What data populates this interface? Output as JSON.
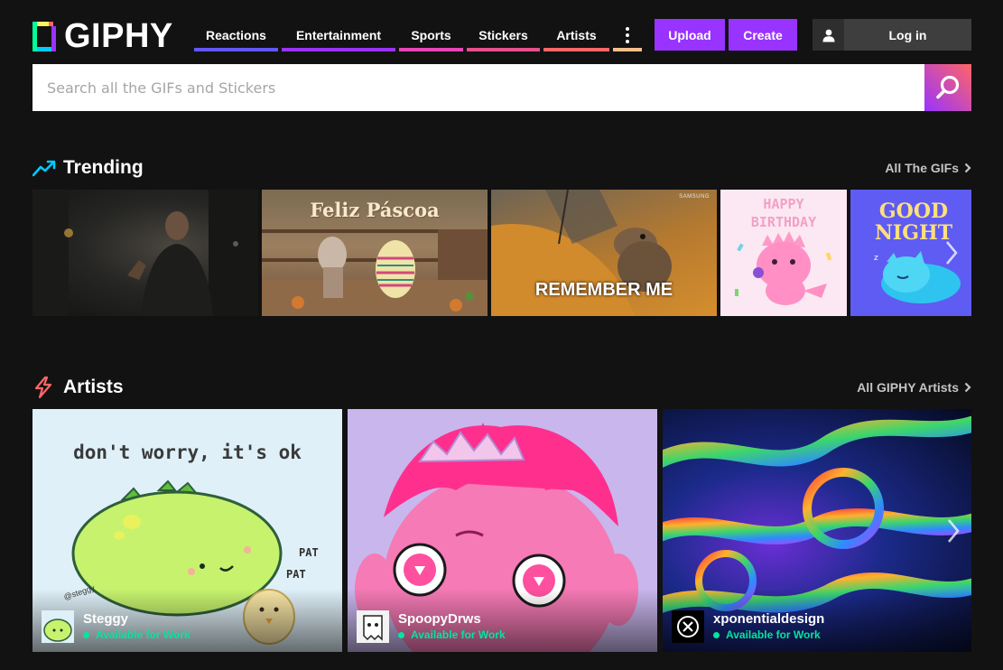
{
  "brand": {
    "name": "GIPHY"
  },
  "nav": {
    "items": [
      {
        "label": "Reactions",
        "color": "#6157ff"
      },
      {
        "label": "Entertainment",
        "color": "#9933ff"
      },
      {
        "label": "Sports",
        "color": "#e646b6"
      },
      {
        "label": "Stickers",
        "color": "#e6508c"
      },
      {
        "label": "Artists",
        "color": "#ff6666"
      }
    ],
    "more_color": "#fff35c"
  },
  "header_buttons": {
    "upload_label": "Upload",
    "create_label": "Create",
    "login_label": "Log in"
  },
  "search": {
    "placeholder": "Search all the GIFs and Stickers"
  },
  "trending": {
    "title": "Trending",
    "link_label": "All The GIFs",
    "gifs": [
      {
        "caption": ""
      },
      {
        "caption": "Feliz Páscoa"
      },
      {
        "caption": "REMEMBER ME",
        "brand": "SAMSUNG"
      },
      {
        "caption_line1": "HAPPY",
        "caption_line2": "BIRTHDAY"
      },
      {
        "caption_line1": "GOOD",
        "caption_line2": "NIGHT"
      }
    ]
  },
  "artists": {
    "title": "Artists",
    "link_label": "All GIPHY Artists",
    "cards": [
      {
        "name": "Steggy",
        "status": "Available for Work",
        "art_text": "don't worry, it's ok",
        "pat1": "PAT",
        "pat2": "PAT",
        "handle": "@steggy"
      },
      {
        "name": "SpoopyDrws",
        "status": "Available for Work"
      },
      {
        "name": "xponentialdesign",
        "status": "Available for Work"
      }
    ]
  },
  "colors": {
    "background": "#121212",
    "accent_purple": "#9933ff",
    "status_green": "#00e6a0",
    "trending_icon": "#00ccff",
    "artists_icon": "#ff6666"
  },
  "icons": [
    "trending-arrow-icon",
    "lightning-icon",
    "search-icon",
    "user-icon",
    "chevron-right-icon",
    "more-dots-icon"
  ]
}
